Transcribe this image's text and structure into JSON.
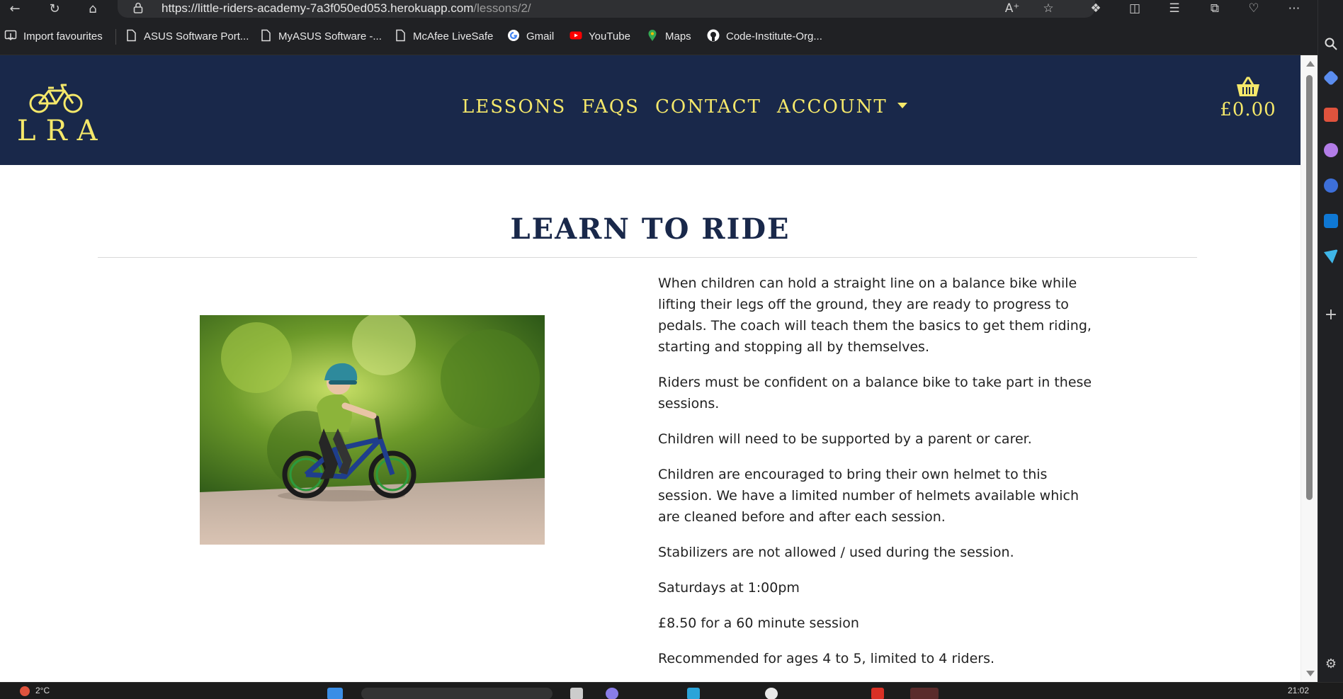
{
  "browser": {
    "url_main": "https://little-riders-academy-7a3f050ed053.herokuapp.com",
    "url_path": "/lessons/2/",
    "bookmarks": [
      {
        "label": "Import favourites",
        "icon": "import-icon"
      },
      {
        "label": "ASUS Software Port...",
        "icon": "page-icon"
      },
      {
        "label": "MyASUS Software -...",
        "icon": "page-icon"
      },
      {
        "label": "McAfee LiveSafe",
        "icon": "page-icon"
      },
      {
        "label": "Gmail",
        "icon": "google-icon"
      },
      {
        "label": "YouTube",
        "icon": "youtube-icon"
      },
      {
        "label": "Maps",
        "icon": "maps-icon"
      },
      {
        "label": "Code-Institute-Org...",
        "icon": "github-icon"
      }
    ]
  },
  "site": {
    "logo_text": "LRA",
    "nav": {
      "lessons": "LESSONS",
      "faqs": "FAQS",
      "contact": "CONTACT",
      "account": "ACCOUNT"
    },
    "basket_total": "£0.00"
  },
  "lesson": {
    "title": "LEARN TO RIDE",
    "paragraphs": [
      "When children can hold a straight line on a balance bike while lifting their legs off the ground, they are ready to progress to pedals. The coach will teach them the basics to get them riding, starting and stopping all by themselves.",
      "Riders must be confident on a balance bike to take part in these sessions.",
      "Children will need to be supported by a parent or carer.",
      "Children are encouraged to bring their own helmet to this session. We have a limited number of helmets available which are cleaned before and after each session.",
      "Stabilizers are not allowed / used during the session.",
      "Saturdays at 1:00pm",
      "£8.50 for a 60 minute session",
      "Recommended for ages 4 to 5, limited to 4 riders."
    ]
  },
  "taskbar": {
    "temperature": "2°C",
    "clock": "21:02"
  },
  "colors": {
    "navy": "#19284a",
    "accent_yellow": "#f5e86a"
  }
}
